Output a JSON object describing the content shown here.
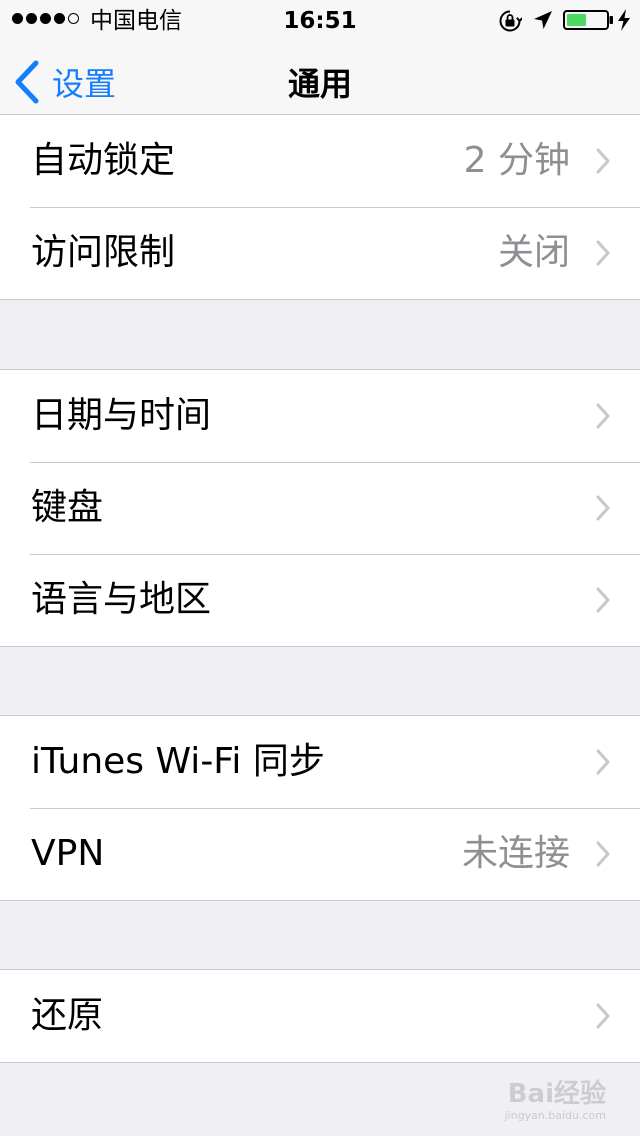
{
  "status_bar": {
    "signal_dots_filled": 4,
    "signal_dots_total": 5,
    "carrier": "中国电信",
    "time": "16:51",
    "icons": [
      "orientation-lock-icon",
      "location-arrow-icon",
      "battery-icon",
      "charging-icon"
    ],
    "battery_level": 0.5,
    "battery_color": "#4cd964"
  },
  "nav": {
    "back_label": "设置",
    "title": "通用",
    "accent": "#157efb"
  },
  "groups": [
    {
      "rows": [
        {
          "label": "自动锁定",
          "value": "2 分钟"
        },
        {
          "label": "访问限制",
          "value": "关闭"
        }
      ]
    },
    {
      "rows": [
        {
          "label": "日期与时间",
          "value": ""
        },
        {
          "label": "键盘",
          "value": ""
        },
        {
          "label": "语言与地区",
          "value": ""
        }
      ]
    },
    {
      "rows": [
        {
          "label": "iTunes Wi-Fi 同步",
          "value": ""
        },
        {
          "label": "VPN",
          "value": "未连接"
        }
      ]
    },
    {
      "rows": [
        {
          "label": "还原",
          "value": ""
        }
      ]
    }
  ],
  "watermark": {
    "text": "Bai经验",
    "sub": "jingyan.baidu.com"
  }
}
